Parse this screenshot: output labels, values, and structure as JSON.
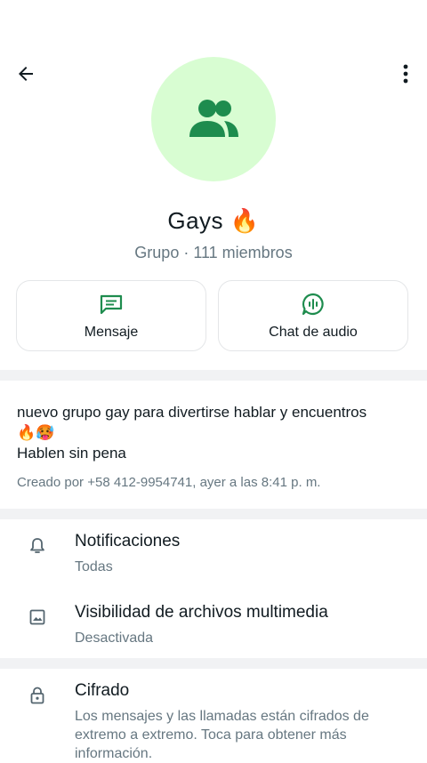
{
  "header": {
    "back_icon": "arrow-back-icon",
    "menu_icon": "more-vert-icon",
    "avatar_icon": "group-icon",
    "avatar_bg": "#d8fdd2",
    "accent": "#1e8c4e"
  },
  "group": {
    "name": "Gays 🔥",
    "subtitle": "Grupo · 111 miembros"
  },
  "actions": [
    {
      "label": "Mensaje",
      "icon": "message-icon"
    },
    {
      "label": "Chat de audio",
      "icon": "audio-chat-icon"
    }
  ],
  "description": {
    "line1": "nuevo grupo gay para divertirse hablar y encuentros",
    "line2": "🔥🥵",
    "line3": "Hablen sin pena",
    "created": "Creado por +58 412-9954741, ayer a las 8:41 p. m."
  },
  "settings": [
    {
      "title": "Notificaciones",
      "subtitle": "Todas",
      "icon": "bell-icon"
    },
    {
      "title": "Visibilidad de archivos multimedia",
      "subtitle": "Desactivada",
      "icon": "image-icon"
    }
  ],
  "encryption": {
    "title": "Cifrado",
    "subtitle": "Los mensajes y las llamadas están cifrados de extremo a extremo. Toca para obtener más información.",
    "icon": "lock-icon"
  }
}
